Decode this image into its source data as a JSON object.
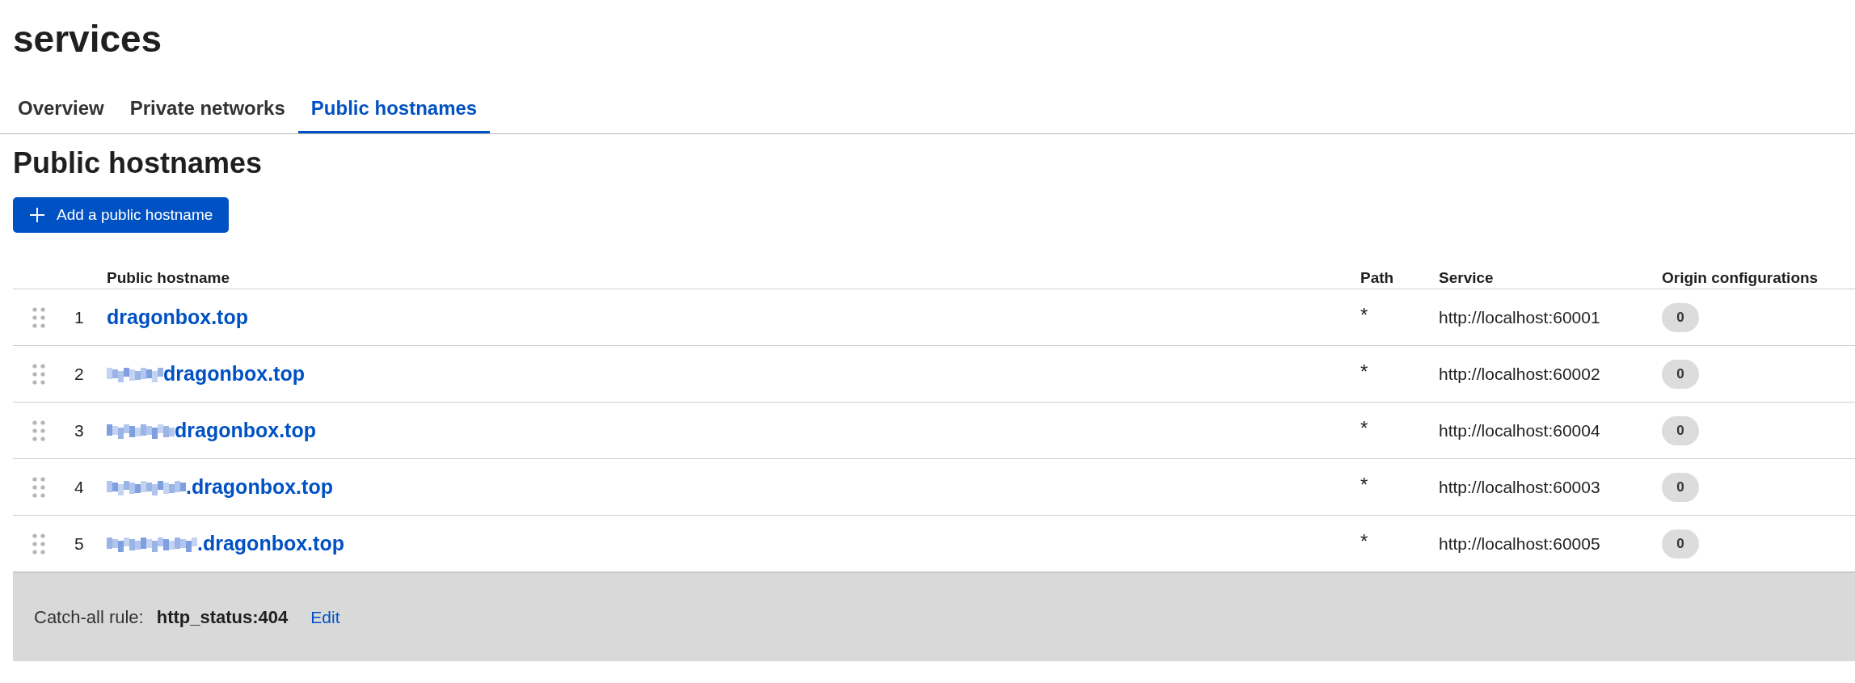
{
  "page_title": "services",
  "tabs": [
    {
      "label": "Overview",
      "selected": false
    },
    {
      "label": "Private networks",
      "selected": false
    },
    {
      "label": "Public hostnames",
      "selected": true
    }
  ],
  "section_title": "Public hostnames",
  "add_button": "Add a public hostname",
  "table": {
    "columns": [
      "Public hostname",
      "Path",
      "Service",
      "Origin configurations"
    ],
    "rows": [
      {
        "index": "1",
        "redacted": false,
        "hostname": "dragonbox.top",
        "path": "*",
        "service": "http://localhost:60001",
        "origin_configurations": "0"
      },
      {
        "index": "2",
        "redacted": true,
        "hostname": "dragonbox.top",
        "path": "*",
        "service": "http://localhost:60002",
        "origin_configurations": "0"
      },
      {
        "index": "3",
        "redacted": true,
        "hostname": "dragonbox.top",
        "path": "*",
        "service": "http://localhost:60004",
        "origin_configurations": "0"
      },
      {
        "index": "4",
        "redacted": true,
        "hostname": ".dragonbox.top",
        "path": "*",
        "service": "http://localhost:60003",
        "origin_configurations": "0"
      },
      {
        "index": "5",
        "redacted": true,
        "hostname": ".dragonbox.top",
        "path": "*",
        "service": "http://localhost:60005",
        "origin_configurations": "0"
      }
    ]
  },
  "catch_all": {
    "label": "Catch-all rule:",
    "value": "http_status:404",
    "edit": "Edit"
  }
}
